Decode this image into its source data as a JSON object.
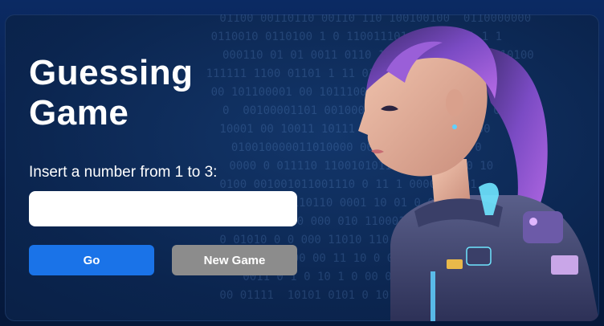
{
  "title": "Guessing Game",
  "prompt": "Insert a number from 1 to 3:",
  "input": {
    "value": "",
    "placeholder": ""
  },
  "buttons": {
    "go": "Go",
    "new_game": "New Game"
  },
  "colors": {
    "accent": "#1a73e8",
    "secondary": "#8c8c8c",
    "background": "#0b254f"
  },
  "decor": {
    "binary_rows": [
      "        01100 00110110 00110 110 100100100  0110000000",
      "      0110010 0110100 1 0 110011101 1  1111 1 1 1",
      "       000110 01 01 0011 0110 110 0011010111 10110100",
      "      111111 1100 01101 1 11 0101100 0000011 0 0 00",
      "      00 101100001 00 1011100 0 01 01 00 1 010",
      "       0  00100001101 00100001110 1 0100 01 01 0 0",
      "        10001 00 10011 10111 110 01 0011 0011 00",
      "         010010000011010000 00 100 010 10 01 0",
      "        0000 0 011110 1100101011 0 00 001100 10",
      "        0100 001001011001110 0 11 1 0000 1 101",
      "          0 01 000110110 0001 10 01 0 00100 1",
      "        0 00 10 0 0 000 010 110001 0 010 0",
      "        0 01010 0 0 000 11010 110 110 11 01",
      "           110000 00 00 11 10 0 01 10 0110",
      "          0011 0 1 0 10 1 0 00 00 1 10",
      "        00 01111  10101 0101 0 101 01 0"
    ]
  }
}
